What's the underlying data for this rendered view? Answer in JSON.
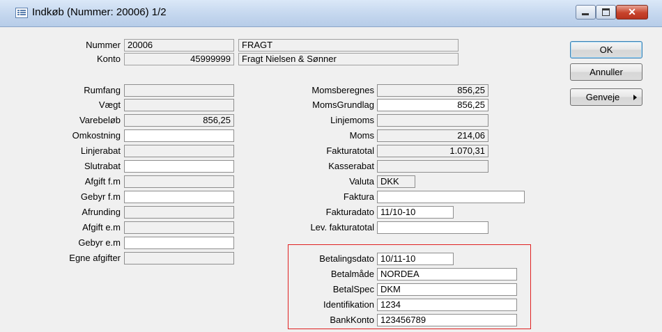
{
  "window": {
    "title": "Indkøb (Nummer: 20006) 1/2"
  },
  "header": {
    "nummer_label": "Nummer",
    "nummer_value": "20006",
    "nummer_name": "FRAGT",
    "konto_label": "Konto",
    "konto_value": "45999999",
    "konto_name": "Fragt Nielsen & Sønner"
  },
  "left": [
    {
      "label": "Rumfang",
      "value": ""
    },
    {
      "label": "Vægt",
      "value": ""
    },
    {
      "label": "Varebeløb",
      "value": "856,25"
    },
    {
      "label": "Omkostning",
      "value": ""
    },
    {
      "label": "Linjerabat",
      "value": ""
    },
    {
      "label": "Slutrabat",
      "value": ""
    },
    {
      "label": "Afgift f.m",
      "value": ""
    },
    {
      "label": "Gebyr f.m",
      "value": ""
    },
    {
      "label": "Afrunding",
      "value": ""
    },
    {
      "label": "Afgift e.m",
      "value": ""
    },
    {
      "label": "Gebyr e.m",
      "value": ""
    },
    {
      "label": "Egne afgifter",
      "value": ""
    }
  ],
  "middle": [
    {
      "label": "Momsberegnes",
      "value": "856,25"
    },
    {
      "label": "MomsGrundlag",
      "value": "856,25"
    },
    {
      "label": "Linjemoms",
      "value": ""
    },
    {
      "label": "Moms",
      "value": "214,06"
    },
    {
      "label": "Fakturatotal",
      "value": "1.070,31"
    },
    {
      "label": "Kasserabat",
      "value": ""
    },
    {
      "label": "Valuta",
      "value": "DKK"
    },
    {
      "label": "Faktura",
      "value": ""
    },
    {
      "label": "Fakturadato",
      "value": "11/10-10"
    },
    {
      "label": "Lev. fakturatotal",
      "value": ""
    }
  ],
  "payment": [
    {
      "label": "Betalingsdato",
      "value": "10/11-10"
    },
    {
      "label": "Betalmåde",
      "value": "NORDEA"
    },
    {
      "label": "BetalSpec",
      "value": "DKM"
    },
    {
      "label": "Identifikation",
      "value": "1234"
    },
    {
      "label": "BankKonto",
      "value": "123456789"
    }
  ],
  "buttons": {
    "ok": "OK",
    "cancel": "Annuller",
    "shortcuts": "Genveje"
  }
}
